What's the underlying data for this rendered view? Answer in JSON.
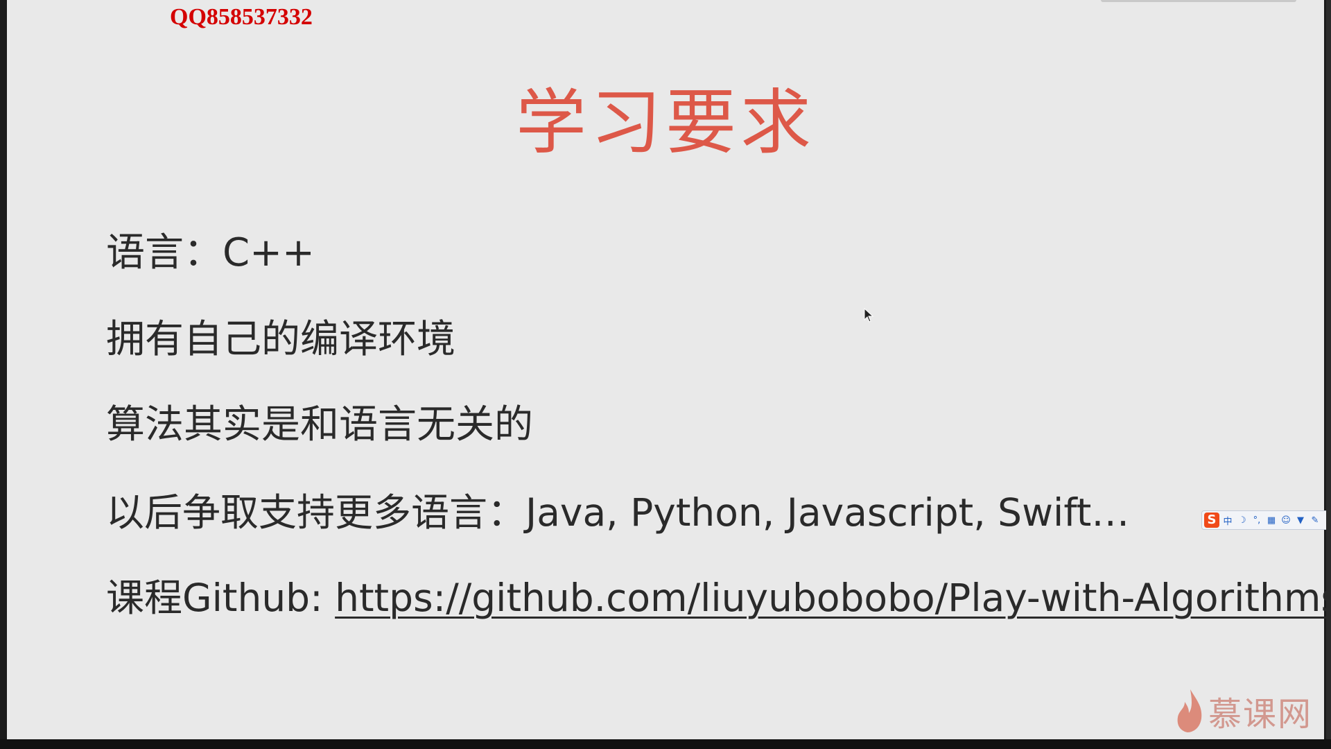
{
  "watermark": {
    "qq": "QQ858537332"
  },
  "slide": {
    "title": "学习要求",
    "lines": [
      {
        "text": "语言：C++"
      },
      {
        "text": "拥有自己的编译环境"
      },
      {
        "text": "算法其实是和语言无关的"
      },
      {
        "text": "以后争取支持更多语言：Java, Python, Javascript, Swift…"
      },
      {
        "prefix": "课程Github: ",
        "link": "https://github.com/liuyubobobo/Play-with-Algorithms"
      }
    ]
  },
  "ime_toolbar": {
    "logo": "S",
    "mode": "中",
    "icons": [
      "moon-icon",
      "punctuation-icon",
      "keyboard-icon",
      "user-icon",
      "shirt-icon",
      "wrench-icon"
    ]
  },
  "brand_watermark": {
    "text": "慕课网",
    "icon": "flame-icon",
    "color": "#cf8b80"
  },
  "colors": {
    "title": "#dd5848",
    "qq": "#d40000",
    "body_text": "#2a2a2a",
    "slide_bg": "#e9e9e9"
  }
}
